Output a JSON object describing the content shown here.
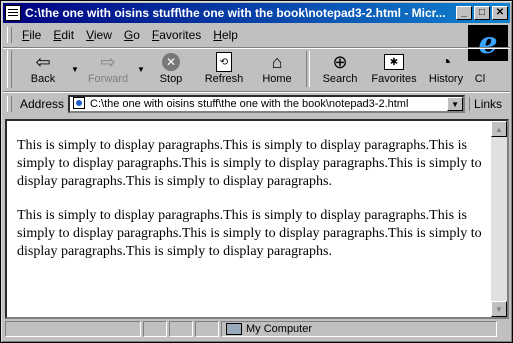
{
  "window": {
    "title": "C:\\the one with oisins stuff\\the one with the book\\notepad3-2.html - Micr..."
  },
  "menu": {
    "items": [
      {
        "label": "File",
        "key": "F",
        "rest": "ile"
      },
      {
        "label": "Edit",
        "key": "E",
        "rest": "dit"
      },
      {
        "label": "View",
        "key": "V",
        "rest": "iew"
      },
      {
        "label": "Go",
        "key": "G",
        "rest": "o"
      },
      {
        "label": "Favorites",
        "key": "F",
        "rest": "avorites"
      },
      {
        "label": "Help",
        "key": "H",
        "rest": "elp"
      }
    ]
  },
  "toolbar": {
    "back": "Back",
    "forward": "Forward",
    "stop": "Stop",
    "refresh": "Refresh",
    "home": "Home",
    "search": "Search",
    "favorites": "Favorites",
    "history": "History",
    "channels": "Cl"
  },
  "address": {
    "label": "Address",
    "value": "C:\\the one with oisins stuff\\the one with the book\\notepad3-2.html",
    "links": "Links"
  },
  "document": {
    "paragraphs": [
      "This is simply to display paragraphs.This is simply to display paragraphs.This is simply to display paragraphs.This is simply to display paragraphs.This is simply to display paragraphs.This is simply to display paragraphs.",
      "This is simply to display paragraphs.This is simply to display paragraphs.This is simply to display paragraphs.This is simply to display paragraphs.This is simply to display paragraphs.This is simply to display paragraphs."
    ]
  },
  "status": {
    "zone": "My Computer"
  }
}
